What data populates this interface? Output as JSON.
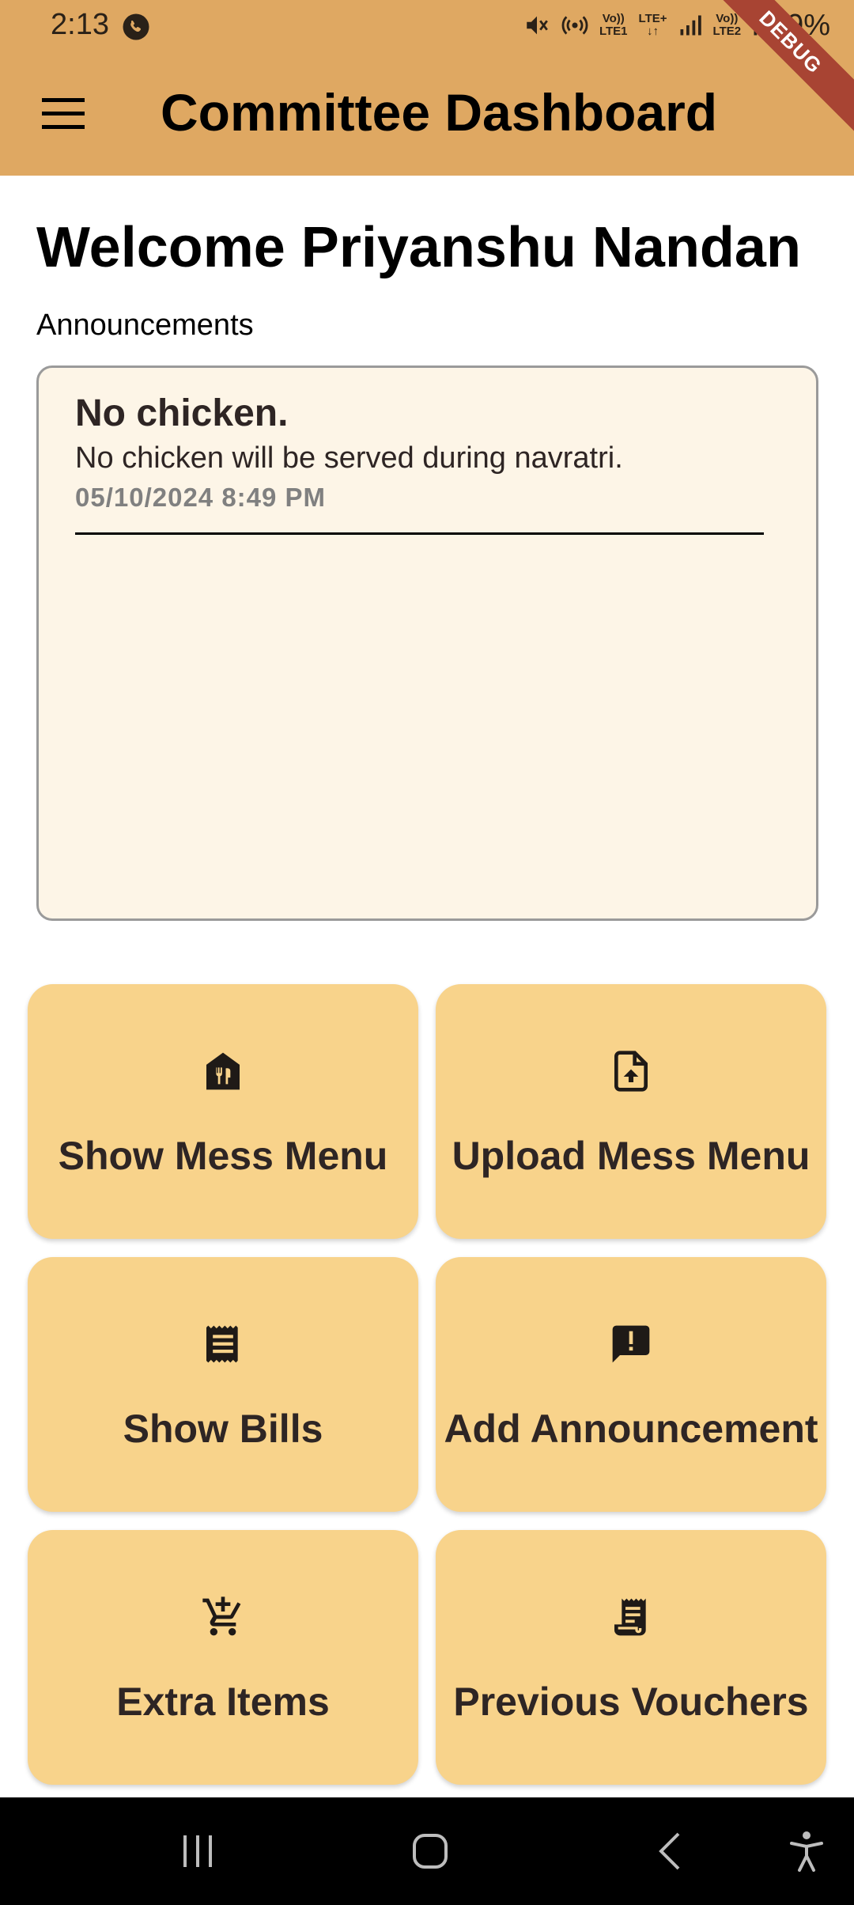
{
  "status_bar": {
    "time": "2:13",
    "sim1_label_top": "Vo))",
    "sim1_label_bottom": "LTE1",
    "sim1_net_top": "LTE+",
    "sim2_label_top": "Vo))",
    "sim2_label_bottom": "LTE2",
    "battery": "9%",
    "icons": [
      "phone-call-icon",
      "mute-icon",
      "hotspot-icon",
      "signal-icon",
      "battery-icon"
    ]
  },
  "debug_banner": "DEBUG",
  "app_bar": {
    "title": "Committee Dashboard",
    "menu_icon": "hamburger-menu-icon"
  },
  "welcome": "Welcome Priyanshu Nandan",
  "announcements": {
    "label": "Announcements",
    "items": [
      {
        "title": "No chicken.",
        "body": "No chicken will be served during navratri.",
        "date": "05/10/2024 8:49 PM"
      }
    ]
  },
  "actions": [
    {
      "label": "Show Mess Menu",
      "icon": "restaurant-house-icon"
    },
    {
      "label": "Upload Mess Menu",
      "icon": "upload-file-icon"
    },
    {
      "label": "Show Bills",
      "icon": "receipt-icon"
    },
    {
      "label": "Add Announcement",
      "icon": "announcement-icon"
    },
    {
      "label": "Extra Items",
      "icon": "add-shopping-cart-icon"
    },
    {
      "label": "Previous Vouchers",
      "icon": "receipt-long-icon"
    }
  ],
  "colors": {
    "app_bar": "#DFA862",
    "card": "#F8D38B",
    "announcement_bg": "#FDF5E7",
    "debug_banner": "#A84433"
  },
  "nav_bar": {
    "icons": [
      "recents-icon",
      "home-icon",
      "back-icon",
      "accessibility-icon"
    ]
  }
}
